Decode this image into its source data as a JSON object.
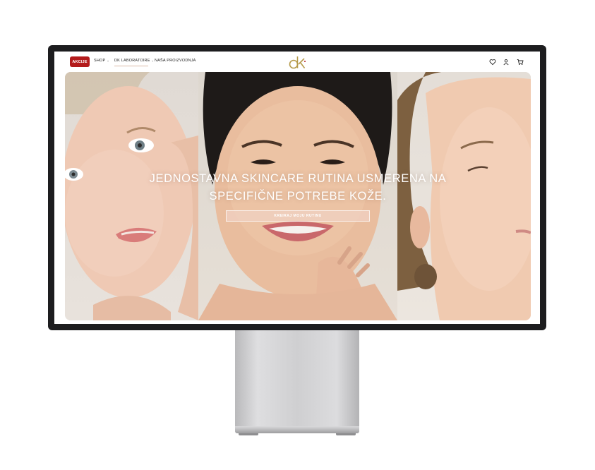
{
  "nav": {
    "promo_label": "AKCIJE",
    "links": [
      {
        "label": "SHOP"
      },
      {
        "label": "DK LABORATOIRE"
      },
      {
        "label": "NAŠA PROIZVODNJA"
      }
    ],
    "logo_text": "dk",
    "icons": [
      "heart-icon",
      "user-icon",
      "cart-icon"
    ]
  },
  "hero": {
    "title_line1": "JEDNOSTAVNA SKINCARE RUTINA USMERENA NA",
    "title_line2": "SPECIFIČNE POTREBE KOŽE.",
    "cta_label": "KREIRAJ MOJU RUTINU"
  },
  "colors": {
    "promo": "#b31b1b",
    "logo_gold": "#b59a4a",
    "bezel": "#1d1d1f"
  }
}
